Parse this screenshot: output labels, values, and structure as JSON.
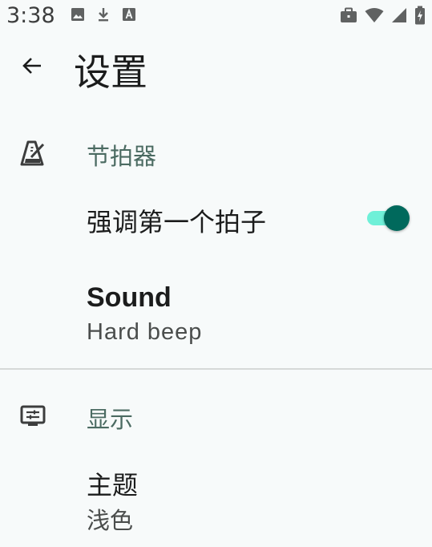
{
  "status_bar": {
    "time": "3:38",
    "left_icons": [
      "image-icon",
      "download-icon",
      "font-icon"
    ],
    "right_icons": [
      "briefcase-icon",
      "wifi-icon",
      "cell-signal-icon",
      "battery-charging-icon"
    ]
  },
  "app_bar": {
    "title": "设置",
    "back_icon": "arrow-back-icon"
  },
  "sections": {
    "metronome": {
      "title": "节拍器",
      "icon": "metronome-icon",
      "accent_first_beat": {
        "title": "强调第一个拍子",
        "enabled": true
      },
      "sound": {
        "title": "Sound",
        "value": "Hard beep"
      }
    },
    "display": {
      "title": "显示",
      "icon": "display-settings-icon",
      "theme": {
        "title": "主题",
        "value": "浅色"
      }
    }
  },
  "colors": {
    "background": "#f7fafa",
    "category_text": "#4b6b62",
    "switch_thumb": "#00695c",
    "switch_track": "#6ff0d8",
    "divider": "#d6d9d8"
  }
}
